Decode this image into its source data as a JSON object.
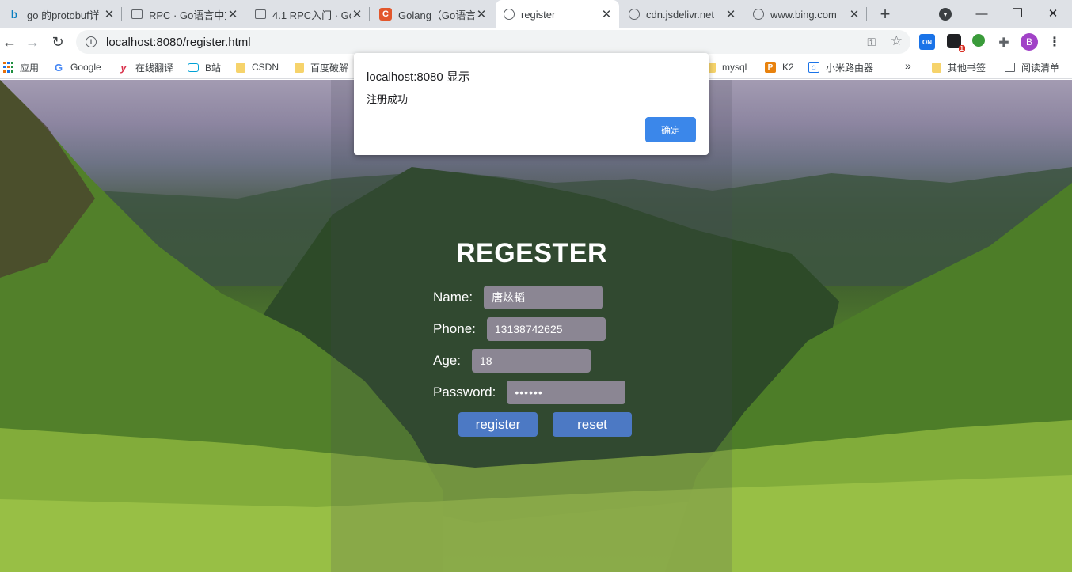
{
  "tabs": [
    {
      "title": "go 的protobuf详",
      "icon": "bing-icon"
    },
    {
      "title": "RPC · Go语言中文",
      "icon": "book-icon"
    },
    {
      "title": "4.1 RPC入门 · Go",
      "icon": "book-icon"
    },
    {
      "title": "Golang（Go语言",
      "icon": "csdn-icon"
    },
    {
      "title": "register",
      "icon": "globe-icon"
    },
    {
      "title": "cdn.jsdelivr.net",
      "icon": "globe-icon"
    },
    {
      "title": "www.bing.com",
      "icon": "globe-icon"
    }
  ],
  "address_bar": {
    "url": "localhost:8080/register.html"
  },
  "extensions": {
    "on_label": "ON",
    "badge_count": "1"
  },
  "profile": {
    "initial": "B"
  },
  "bookmarks": [
    {
      "label": "应用"
    },
    {
      "label": "Google"
    },
    {
      "label": "在线翻译"
    },
    {
      "label": "B站"
    },
    {
      "label": "CSDN"
    },
    {
      "label": "百度破解"
    },
    {
      "label": "mysql"
    },
    {
      "label": "K2"
    },
    {
      "label": "小米路由器"
    },
    {
      "label": "其他书签"
    },
    {
      "label": "阅读清单"
    }
  ],
  "form": {
    "title": "REGESTER",
    "name_label": "Name:",
    "name_value": "唐炫韬",
    "phone_label": "Phone:",
    "phone_value": "13138742625",
    "age_label": "Age:",
    "age_value": "18",
    "password_label": "Password:",
    "password_value": "••••••",
    "register_label": "register",
    "reset_label": "reset"
  },
  "dialog": {
    "title": "localhost:8080 显示",
    "message": "注册成功",
    "ok_label": "确定"
  },
  "colors": {
    "button_blue": "#4c79c4",
    "dialog_ok": "#3b87ea",
    "tabstrip": "#dee1e6"
  }
}
